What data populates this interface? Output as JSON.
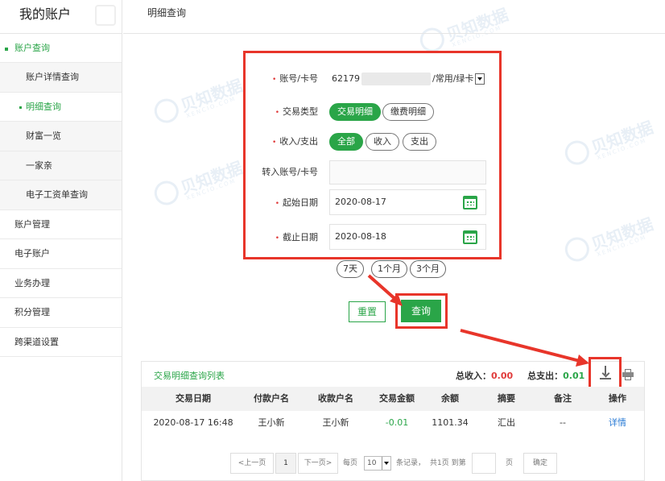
{
  "sidebar": {
    "brand": "我的账户",
    "group_account_query": "账户查询",
    "sub_items": [
      "账户详情查询",
      "明细查询",
      "财富一览",
      "一家亲",
      "电子工资单查询"
    ],
    "items": [
      "账户管理",
      "电子账户",
      "业务办理",
      "积分管理",
      "跨渠道设置"
    ]
  },
  "header": {
    "title": "明细查询"
  },
  "form": {
    "account_label": "账号/卡号",
    "account_prefix": "62179",
    "account_suffix": "/常用/绿卡",
    "tx_type_label": "交易类型",
    "tx_type_options": [
      "交易明细",
      "缴费明细"
    ],
    "tx_type_selected": "交易明细",
    "io_label": "收入/支出",
    "io_options": [
      "全部",
      "收入",
      "支出"
    ],
    "io_selected": "全部",
    "transfer_label": "转入账号/卡号",
    "transfer_value": "",
    "start_label": "起始日期",
    "start_value": "2020-08-17",
    "end_label": "截止日期",
    "end_value": "2020-08-18",
    "quick_ranges": [
      "7天",
      "1个月",
      "3个月"
    ],
    "reset_label": "重置",
    "query_label": "查询"
  },
  "results": {
    "title": "交易明细查询列表",
    "total_in_label": "总收入：",
    "total_in": "0.00",
    "total_out_label": "总支出：",
    "total_out": "0.01",
    "columns": [
      "交易日期",
      "付款户名",
      "收款户名",
      "交易金额",
      "余额",
      "摘要",
      "备注",
      "操作"
    ],
    "rows": [
      [
        "2020-08-17 16:48",
        "王小新",
        "王小新",
        "-0.01",
        "1101.34",
        "汇出",
        "--",
        "详情"
      ]
    ],
    "pager": {
      "prev": "<上一页",
      "current": "1",
      "next": "下一页>",
      "per_page_label": "每页",
      "per_page": "10",
      "records_label": "条记录，",
      "total_pages_text": "共1页 到第",
      "page_unit": "页",
      "confirm": "确定"
    }
  },
  "watermark": {
    "brand": "贝知数据",
    "domain": "XENCIO.COM"
  },
  "colors": {
    "accent": "#2aa548",
    "highlight": "#e8352a",
    "link": "#2a7bd5",
    "negative": "#e03b3b"
  }
}
